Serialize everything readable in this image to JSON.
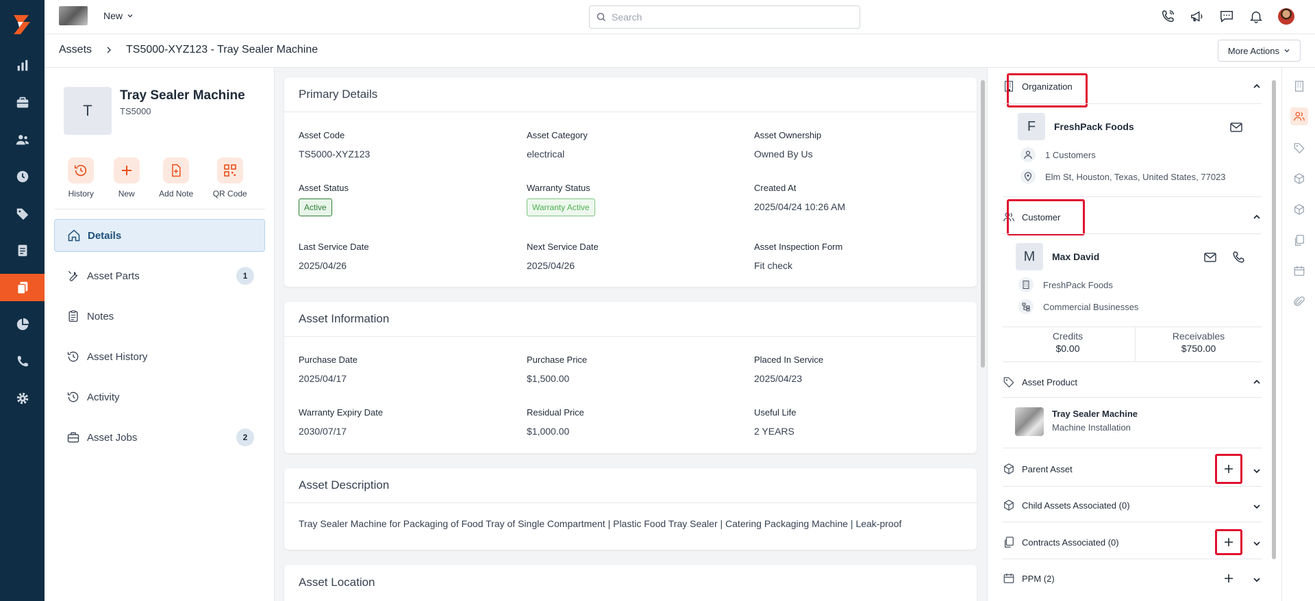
{
  "topbar": {
    "new_label": "New",
    "search_placeholder": "Search"
  },
  "breadcrumb": {
    "root": "Assets",
    "current": "TS5000-XYZ123 - Tray Sealer Machine"
  },
  "more_actions_label": "More Actions",
  "asset": {
    "initial": "T",
    "name": "Tray Sealer Machine",
    "code": "TS5000"
  },
  "quick_actions": {
    "history": "History",
    "new": "New",
    "add_note": "Add Note",
    "qr_code": "QR Code"
  },
  "side_nav": {
    "details": "Details",
    "asset_parts": "Asset Parts",
    "asset_parts_count": "1",
    "notes": "Notes",
    "asset_history": "Asset History",
    "activity": "Activity",
    "asset_jobs": "Asset Jobs",
    "asset_jobs_count": "2"
  },
  "primary_details": {
    "title": "Primary Details",
    "asset_code_label": "Asset Code",
    "asset_code": "TS5000-XYZ123",
    "asset_category_label": "Asset Category",
    "asset_category": "electrical",
    "asset_ownership_label": "Asset Ownership",
    "asset_ownership": "Owned By Us",
    "asset_status_label": "Asset Status",
    "asset_status": "Active",
    "warranty_status_label": "Warranty Status",
    "warranty_status": "Warranty Active",
    "created_at_label": "Created At",
    "created_at": "2025/04/24 10:26 AM",
    "last_service_label": "Last Service Date",
    "last_service": "2025/04/26",
    "next_service_label": "Next Service Date",
    "next_service": "2025/04/26",
    "inspection_form_label": "Asset Inspection Form",
    "inspection_form": "Fit check"
  },
  "asset_information": {
    "title": "Asset Information",
    "purchase_date_label": "Purchase Date",
    "purchase_date": "2025/04/17",
    "purchase_price_label": "Purchase Price",
    "purchase_price": "$1,500.00",
    "placed_in_service_label": "Placed In Service",
    "placed_in_service": "2025/04/23",
    "warranty_expiry_label": "Warranty Expiry Date",
    "warranty_expiry": "2030/07/17",
    "residual_price_label": "Residual Price",
    "residual_price": "$1,000.00",
    "useful_life_label": "Useful Life",
    "useful_life": "2 YEARS"
  },
  "asset_description": {
    "title": "Asset Description",
    "text": "Tray Sealer Machine for Packaging of Food Tray of Single Compartment | Plastic Food Tray Sealer | Catering Packaging Machine | Leak-proof"
  },
  "asset_location": {
    "title": "Asset Location"
  },
  "organization": {
    "heading": "Organization",
    "initial": "F",
    "name": "FreshPack Foods",
    "customers": "1 Customers",
    "address": "Elm St, Houston, Texas, United States, 77023"
  },
  "customer": {
    "heading": "Customer",
    "initial": "M",
    "name": "Max David",
    "organization": "FreshPack Foods",
    "segment": "Commercial Businesses",
    "credits_label": "Credits",
    "credits": "$0.00",
    "receivables_label": "Receivables",
    "receivables": "$750.00"
  },
  "asset_product": {
    "heading": "Asset Product",
    "name": "Tray Sealer Machine",
    "category": "Machine Installation"
  },
  "related": {
    "parent_asset": "Parent Asset",
    "child_assets": "Child Assets Associated (0)",
    "contracts": "Contracts Associated (0)",
    "ppm": "PPM (2)"
  },
  "colors": {
    "brand": "#f05a24",
    "rail": "#0f2d44",
    "highlight": "#e0102f",
    "active_status": "#2e7d32"
  }
}
